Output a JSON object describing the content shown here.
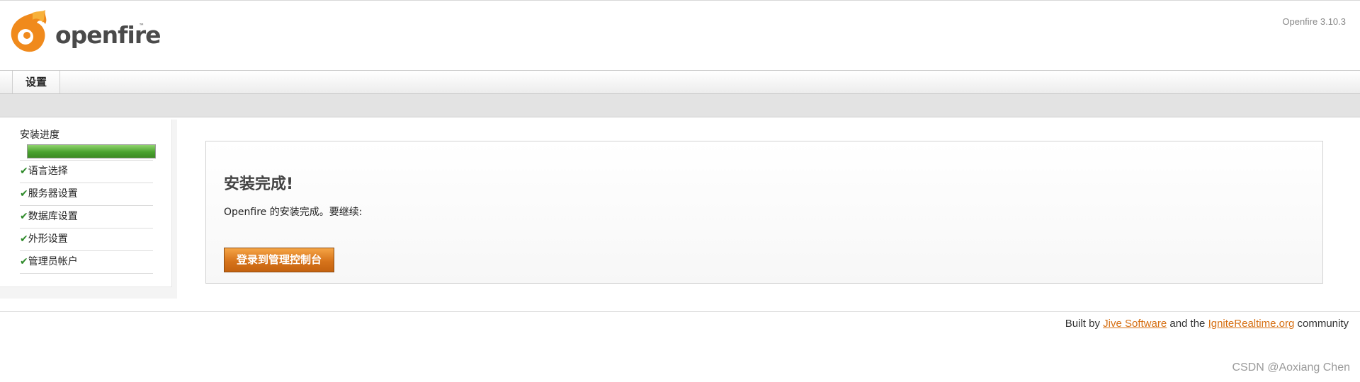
{
  "header": {
    "logo_text": "openfire",
    "logo_tm": "™",
    "version": "Openfire 3.10.3"
  },
  "tabs": [
    {
      "label": "设置"
    }
  ],
  "sidebar": {
    "progress_title": "安装进度",
    "progress": 1.0,
    "check_glyph": "✔",
    "steps": [
      {
        "label": "语言选择"
      },
      {
        "label": "服务器设置"
      },
      {
        "label": "数据库设置"
      },
      {
        "label": "外形设置"
      },
      {
        "label": "管理员帐户"
      }
    ]
  },
  "main": {
    "title": "安装完成!",
    "message": "Openfire 的安装完成。要继续:",
    "login_button": "登录到管理控制台"
  },
  "footer": {
    "prefix": "Built by ",
    "link1": "Jive Software",
    "middle": " and the ",
    "link2": "IgniteRealtime.org",
    "suffix": " community"
  },
  "watermark": "CSDN @Aoxiang Chen",
  "colors": {
    "accent": "#d66f12",
    "progress": "#4aa22f",
    "check": "#2e8a2a"
  }
}
